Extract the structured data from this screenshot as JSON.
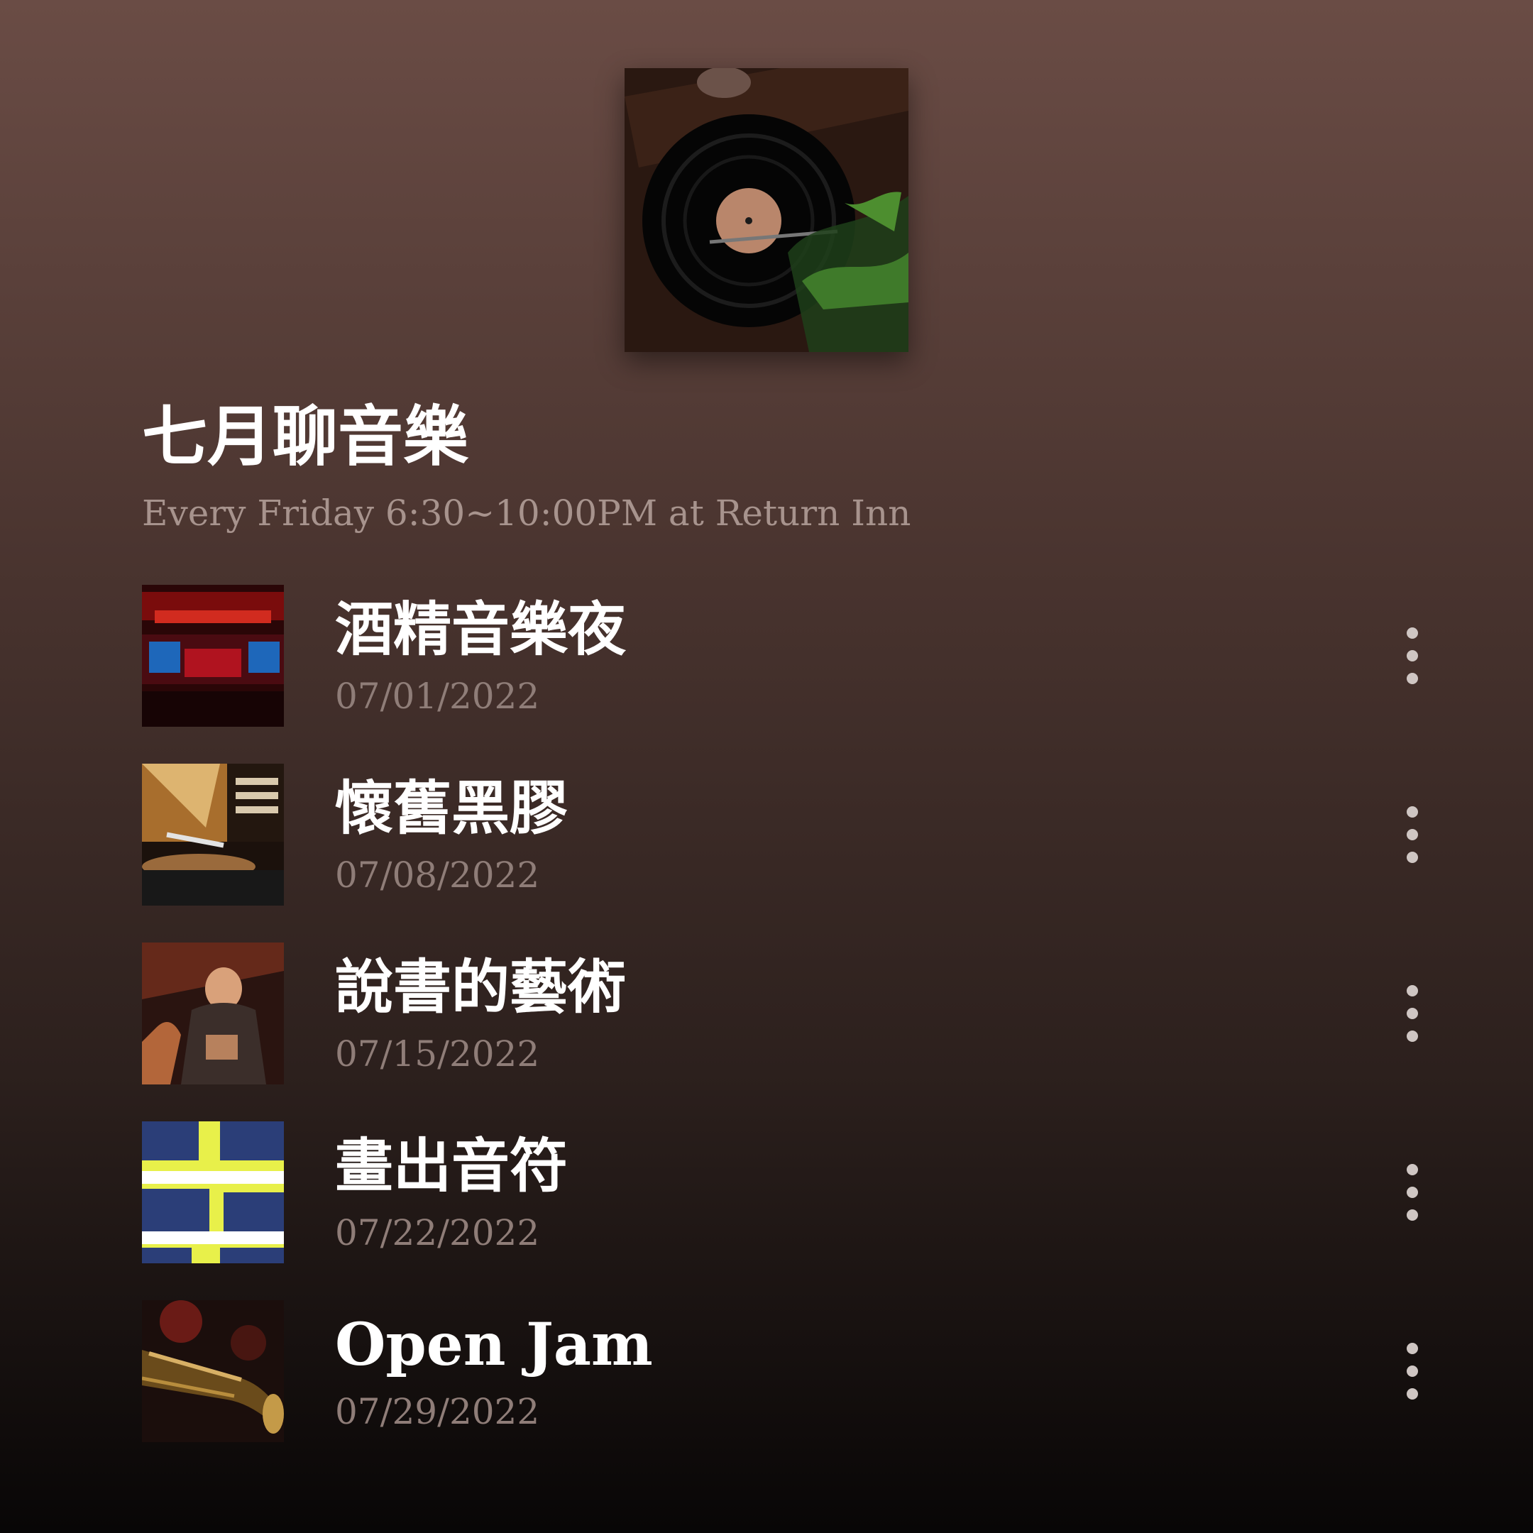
{
  "playlist": {
    "title": "七月聊音樂",
    "subtitle": "Every Friday 6:30~10:00PM at Return Inn",
    "cover_icon": "vinyl-record-turntable"
  },
  "events": [
    {
      "title": "酒精音樂夜",
      "date": "07/01/2022",
      "thumb_icon": "neon-bar"
    },
    {
      "title": "懷舊黑膠",
      "date": "07/08/2022",
      "thumb_icon": "turntable"
    },
    {
      "title": "說書的藝術",
      "date": "07/15/2022",
      "thumb_icon": "storyteller"
    },
    {
      "title": "畫出音符",
      "date": "07/22/2022",
      "thumb_icon": "collage"
    },
    {
      "title": "Open Jam",
      "date": "07/29/2022",
      "thumb_icon": "trumpet"
    }
  ],
  "actions": {
    "more_icon": "more-vertical-icon"
  }
}
